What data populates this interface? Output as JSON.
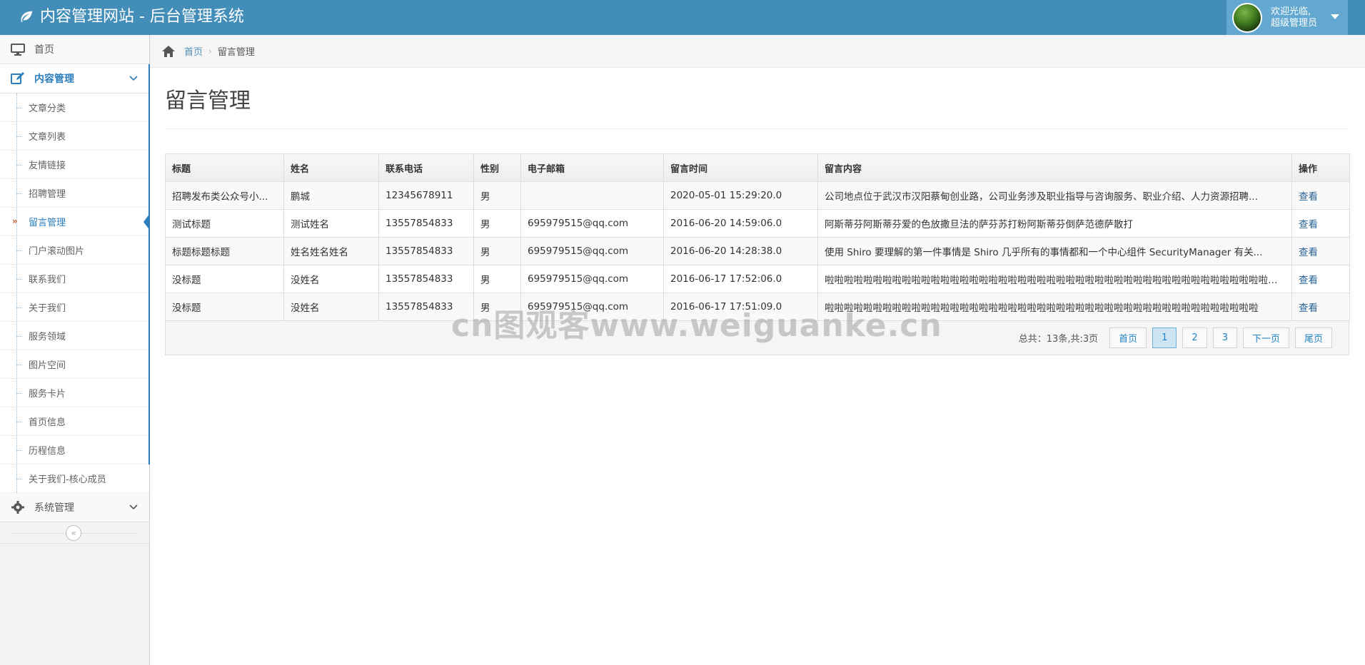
{
  "header": {
    "brand_title": "内容管理网站 - 后台管理系统",
    "user_welcome": "欢迎光临,",
    "user_role": "超级管理员"
  },
  "sidebar": {
    "home_label": "首页",
    "content_menu_label": "内容管理",
    "content_items": [
      {
        "label": "文章分类"
      },
      {
        "label": "文章列表"
      },
      {
        "label": "友情链接"
      },
      {
        "label": "招聘管理"
      },
      {
        "label": "留言管理",
        "active": true
      },
      {
        "label": "门户滚动图片"
      },
      {
        "label": "联系我们"
      },
      {
        "label": "关于我们"
      },
      {
        "label": "服务领域"
      },
      {
        "label": "图片空间"
      },
      {
        "label": "服务卡片"
      },
      {
        "label": "首页信息"
      },
      {
        "label": "历程信息"
      },
      {
        "label": "关于我们-核心成员"
      }
    ],
    "system_menu_label": "系统管理"
  },
  "breadcrumb": {
    "home": "首页",
    "current": "留言管理"
  },
  "page": {
    "title": "留言管理"
  },
  "table": {
    "headers": [
      "标题",
      "姓名",
      "联系电话",
      "性别",
      "电子邮箱",
      "留言时间",
      "留言内容",
      "操作"
    ],
    "rows": [
      [
        "招聘发布类公众号小...",
        "鹏城",
        "12345678911",
        "男",
        "",
        "2020-05-01 15:29:20.0",
        "公司地点位于武汉市汉阳蔡甸创业路，公司业务涉及职业指导与咨询服务、职业介绍、人力资源招聘...",
        "查看"
      ],
      [
        "测试标题",
        "测试姓名",
        "13557854833",
        "男",
        "695979515@qq.com",
        "2016-06-20 14:59:06.0",
        "阿斯蒂芬阿斯蒂芬爱的色放撒旦法的萨芬苏打粉阿斯蒂芬倒萨范德萨散打",
        "查看"
      ],
      [
        "标题标题标题",
        "姓名姓名姓名",
        "13557854833",
        "男",
        "695979515@qq.com",
        "2016-06-20 14:28:38.0",
        "使用 Shiro 要理解的第一件事情是 Shiro 几乎所有的事情都和一个中心组件 SecurityManager 有关...",
        "查看"
      ],
      [
        "没标题",
        "没姓名",
        "13557854833",
        "男",
        "695979515@qq.com",
        "2016-06-17 17:52:06.0",
        "啦啦啦啦啦啦啦啦啦啦啦啦啦啦啦啦啦啦啦啦啦啦啦啦啦啦啦啦啦啦啦啦啦啦啦啦啦啦啦啦啦啦啦啦啦啦啦啦啦啦啦啦啦啦啦啦啦...",
        "查看"
      ],
      [
        "没标题",
        "没姓名",
        "13557854833",
        "男",
        "695979515@qq.com",
        "2016-06-17 17:51:09.0",
        "啦啦啦啦啦啦啦啦啦啦啦啦啦啦啦啦啦啦啦啦啦啦啦啦啦啦啦啦啦啦啦啦啦啦啦啦啦啦啦啦啦啦啦啦啦",
        "查看"
      ]
    ]
  },
  "pagination": {
    "total_text": "总共：13条,共:3页",
    "first": "首页",
    "pages": [
      "1",
      "2",
      "3"
    ],
    "current_page": "1",
    "next": "下一页",
    "last": "尾页"
  },
  "watermark": "cn图观客www.weiguanke.cn",
  "icons": {
    "brand": "leaf-icon",
    "home_nav": "desktop-icon",
    "content_nav": "edit-icon",
    "system_nav": "gear-icon",
    "breadcrumb_home": "home-icon",
    "collapse": "double-chevron-left-icon"
  },
  "colors": {
    "topbar": "#438eb9",
    "user_box": "#62a8d1",
    "accent": "#2b7dbc",
    "link": "#4c8fbd"
  }
}
